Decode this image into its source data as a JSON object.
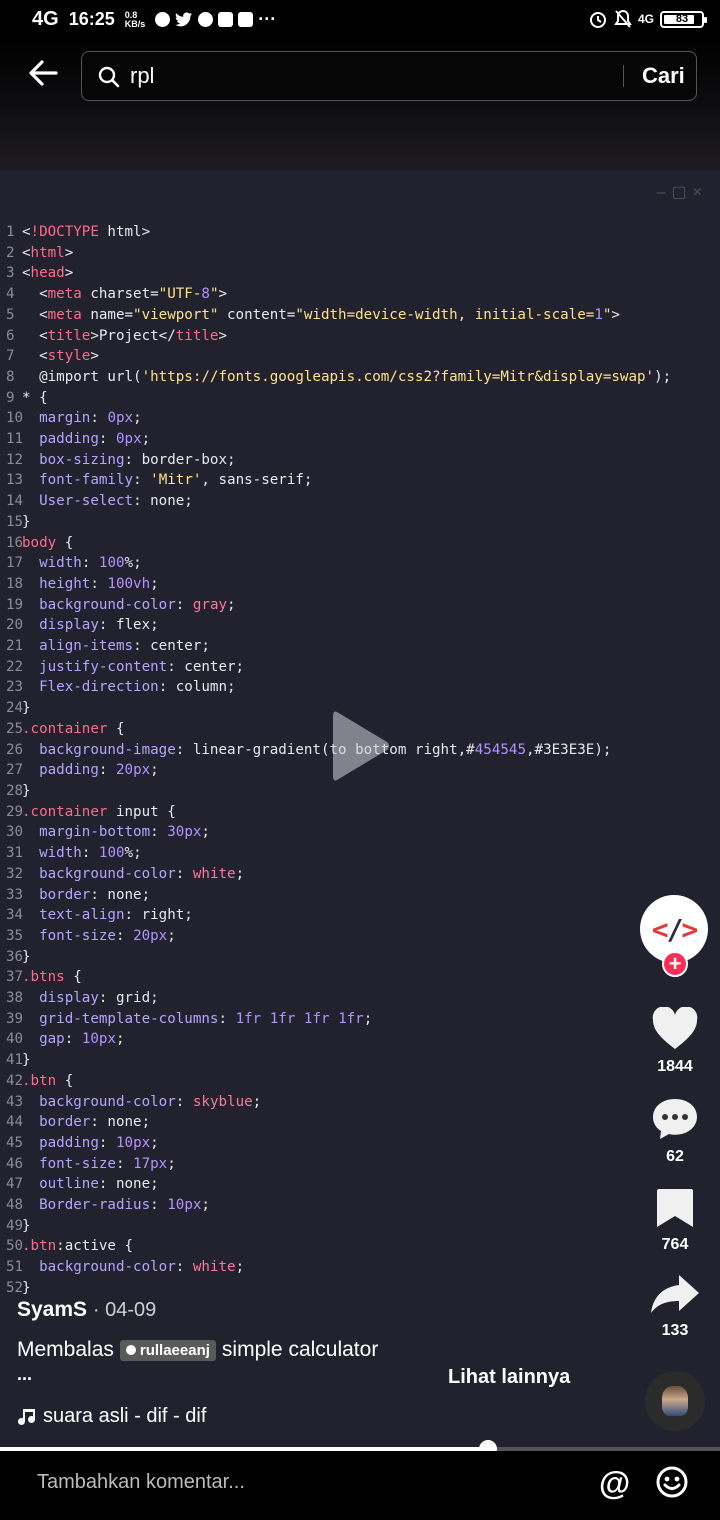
{
  "status": {
    "network": "4G",
    "time": "16:25",
    "speed": "0.8",
    "speed_unit": "KB/s",
    "right_net": "4G",
    "battery": "83",
    "battery_level": 0.83
  },
  "search": {
    "value": "rpl",
    "button": "Cari"
  },
  "code_lines": [
    "<!DOCTYPE html>",
    "<html>",
    "<head>",
    "  <meta charset=\"UTF-8\">",
    "  <meta name=\"viewport\" content=\"width=device-width, initial-scale=1\">",
    "  <title>Project</title>",
    "  <style>",
    "  @import url('https://fonts.googleapis.com/css2?family=Mitr&display=swap');",
    "* {",
    "  margin: 0px;",
    "  padding: 0px;",
    "  box-sizing: border-box;",
    "  font-family: 'Mitr', sans-serif;",
    "  User-select: none;",
    "}",
    "body {",
    "  width: 100%;",
    "  height: 100vh;",
    "  background-color: gray;",
    "  display: flex;",
    "  align-items: center;",
    "  justify-content: center;",
    "  Flex-direction: column;",
    "}",
    ".container {",
    "  background-image: linear-gradient(to bottom right,#454545,#3E3E3E);",
    "  padding: 20px;",
    "}",
    ".container input {",
    "  margin-bottom: 30px;",
    "  width: 100%;",
    "  background-color: white;",
    "  border: none;",
    "  text-align: right;",
    "  font-size: 20px;",
    "}",
    ".btns {",
    "  display: grid;",
    "  grid-template-columns: 1fr 1fr 1fr 1fr;",
    "  gap: 10px;",
    "}",
    ".btn {",
    "  background-color: skyblue;",
    "  border: none;",
    "  padding: 10px;",
    "  font-size: 17px;",
    "  outline: none;",
    "  Border-radius: 10px;",
    "}",
    ".btn:active {",
    "  background-color: white;",
    "}"
  ],
  "actions": {
    "likes": "1844",
    "comments": "62",
    "saves": "764",
    "shares": "133"
  },
  "post": {
    "author": "SyamS",
    "date": "· 04-09",
    "reply_prefix": "Membalas",
    "mention": "rullaeeanj",
    "caption": "simple calculator",
    "ellipsis": "...",
    "see_more": "Lihat lainnya",
    "music": "suara asli - dif - dif"
  },
  "playback": {
    "progress": 0.678
  },
  "comment": {
    "placeholder": "Tambahkan komentar..."
  },
  "colors": {
    "accent": "#fe2c55",
    "code_bg": "#22222e",
    "logo_red": "#e53935",
    "logo_dark": "#2e2e3a"
  }
}
